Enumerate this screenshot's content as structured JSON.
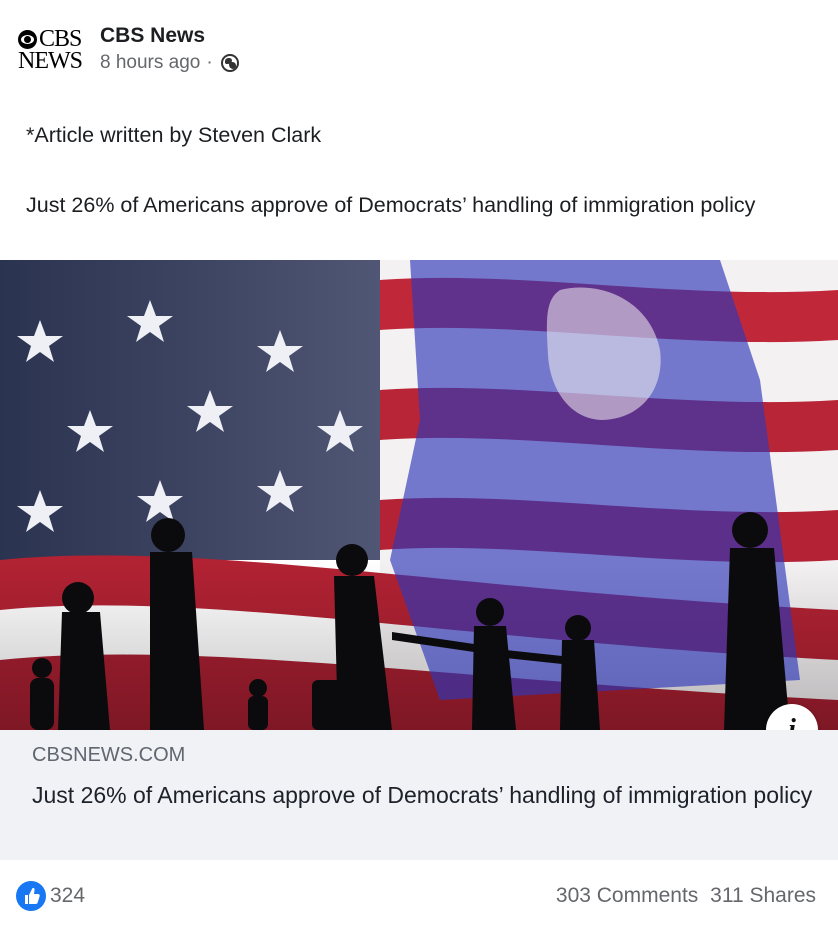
{
  "post": {
    "page_name": "CBS News",
    "logo_line1": "CBS",
    "logo_line2": "NEWS",
    "time": "8 hours ago",
    "separator": "·",
    "privacy_icon": "globe-icon",
    "text_line1": "*Article written by Steven Clark",
    "text_line2": "Just 26% of Americans approve of Democrats’ handling of immigration policy"
  },
  "link": {
    "domain": "CBSNEWS.COM",
    "title": "Just 26% of Americans approve of Democrats’ handling of immigration policy",
    "info_icon": "i"
  },
  "engagement": {
    "like_icon": "thumbs-up-icon",
    "likes": "324",
    "comments": "303 Comments",
    "shares": "311 Shares"
  },
  "colors": {
    "facebook_blue": "#1877f2",
    "meta_gray": "#65676b",
    "link_box_bg": "#f0f2f5"
  }
}
